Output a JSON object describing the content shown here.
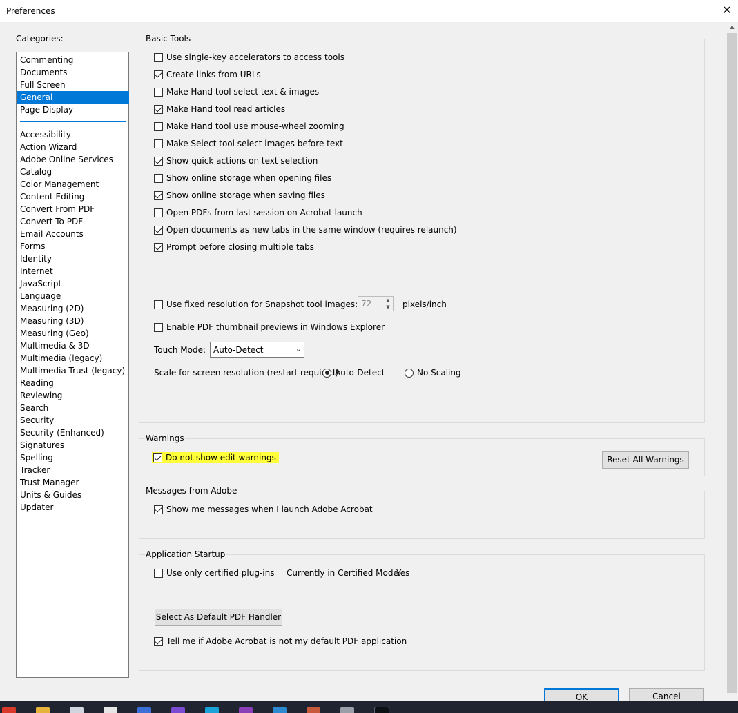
{
  "window": {
    "title": "Preferences"
  },
  "categories": {
    "label": "Categories:",
    "top_items": [
      "Commenting",
      "Documents",
      "Full Screen",
      "General",
      "Page Display"
    ],
    "selected": "General",
    "items": [
      "Accessibility",
      "Action Wizard",
      "Adobe Online Services",
      "Catalog",
      "Color Management",
      "Content Editing",
      "Convert From PDF",
      "Convert To PDF",
      "Email Accounts",
      "Forms",
      "Identity",
      "Internet",
      "JavaScript",
      "Language",
      "Measuring (2D)",
      "Measuring (3D)",
      "Measuring (Geo)",
      "Multimedia & 3D",
      "Multimedia (legacy)",
      "Multimedia Trust (legacy)",
      "Reading",
      "Reviewing",
      "Search",
      "Security",
      "Security (Enhanced)",
      "Signatures",
      "Spelling",
      "Tracker",
      "Trust Manager",
      "Units & Guides",
      "Updater"
    ]
  },
  "basic_tools": {
    "title": "Basic Tools",
    "options": [
      {
        "label": "Use single-key accelerators to access tools",
        "checked": false
      },
      {
        "label": "Create links from URLs",
        "checked": true
      },
      {
        "label": "Make Hand tool select text & images",
        "checked": false
      },
      {
        "label": "Make Hand tool read articles",
        "checked": true
      },
      {
        "label": "Make Hand tool use mouse-wheel zooming",
        "checked": false
      },
      {
        "label": "Make Select tool select images before text",
        "checked": false
      },
      {
        "label": "Show quick actions on text selection",
        "checked": true
      },
      {
        "label": "Show online storage when opening files",
        "checked": false
      },
      {
        "label": "Show online storage when saving files",
        "checked": true
      },
      {
        "label": "Open PDFs from last session on Acrobat launch",
        "checked": false
      },
      {
        "label": "Open documents as new tabs in the same window (requires relaunch)",
        "checked": true
      },
      {
        "label": "Prompt before closing multiple tabs",
        "checked": true
      }
    ],
    "snapshot": {
      "label": "Use fixed resolution for Snapshot tool images:",
      "checked": false,
      "value": "72",
      "unit": "pixels/inch"
    },
    "thumbnail": {
      "label": "Enable PDF thumbnail previews in Windows Explorer",
      "checked": false
    },
    "touch_mode": {
      "label": "Touch Mode:",
      "value": "Auto-Detect"
    },
    "scale": {
      "label": "Scale for screen resolution (restart required):",
      "option1": "Auto-Detect",
      "option2": "No Scaling",
      "selected": "Auto-Detect"
    }
  },
  "warnings": {
    "title": "Warnings",
    "option": {
      "label": "Do not show edit warnings",
      "checked": true,
      "highlight": "#ffff3a"
    },
    "reset_button": "Reset All Warnings"
  },
  "messages": {
    "title": "Messages from Adobe",
    "option": {
      "label": "Show me messages when I launch Adobe Acrobat",
      "checked": true
    }
  },
  "startup": {
    "title": "Application Startup",
    "certified": {
      "label": "Use only certified plug-ins",
      "checked": false
    },
    "certified_mode_label": "Currently in Certified Mode:",
    "certified_mode_value": "Yes",
    "default_button": "Select As Default PDF Handler",
    "tell_me": {
      "label": "Tell me if Adobe Acrobat is not my default PDF application",
      "checked": true
    }
  },
  "buttons": {
    "ok": "OK",
    "cancel": "Cancel"
  },
  "colors": {
    "accent": "#0078d7",
    "highlight": "#ffff3a"
  }
}
